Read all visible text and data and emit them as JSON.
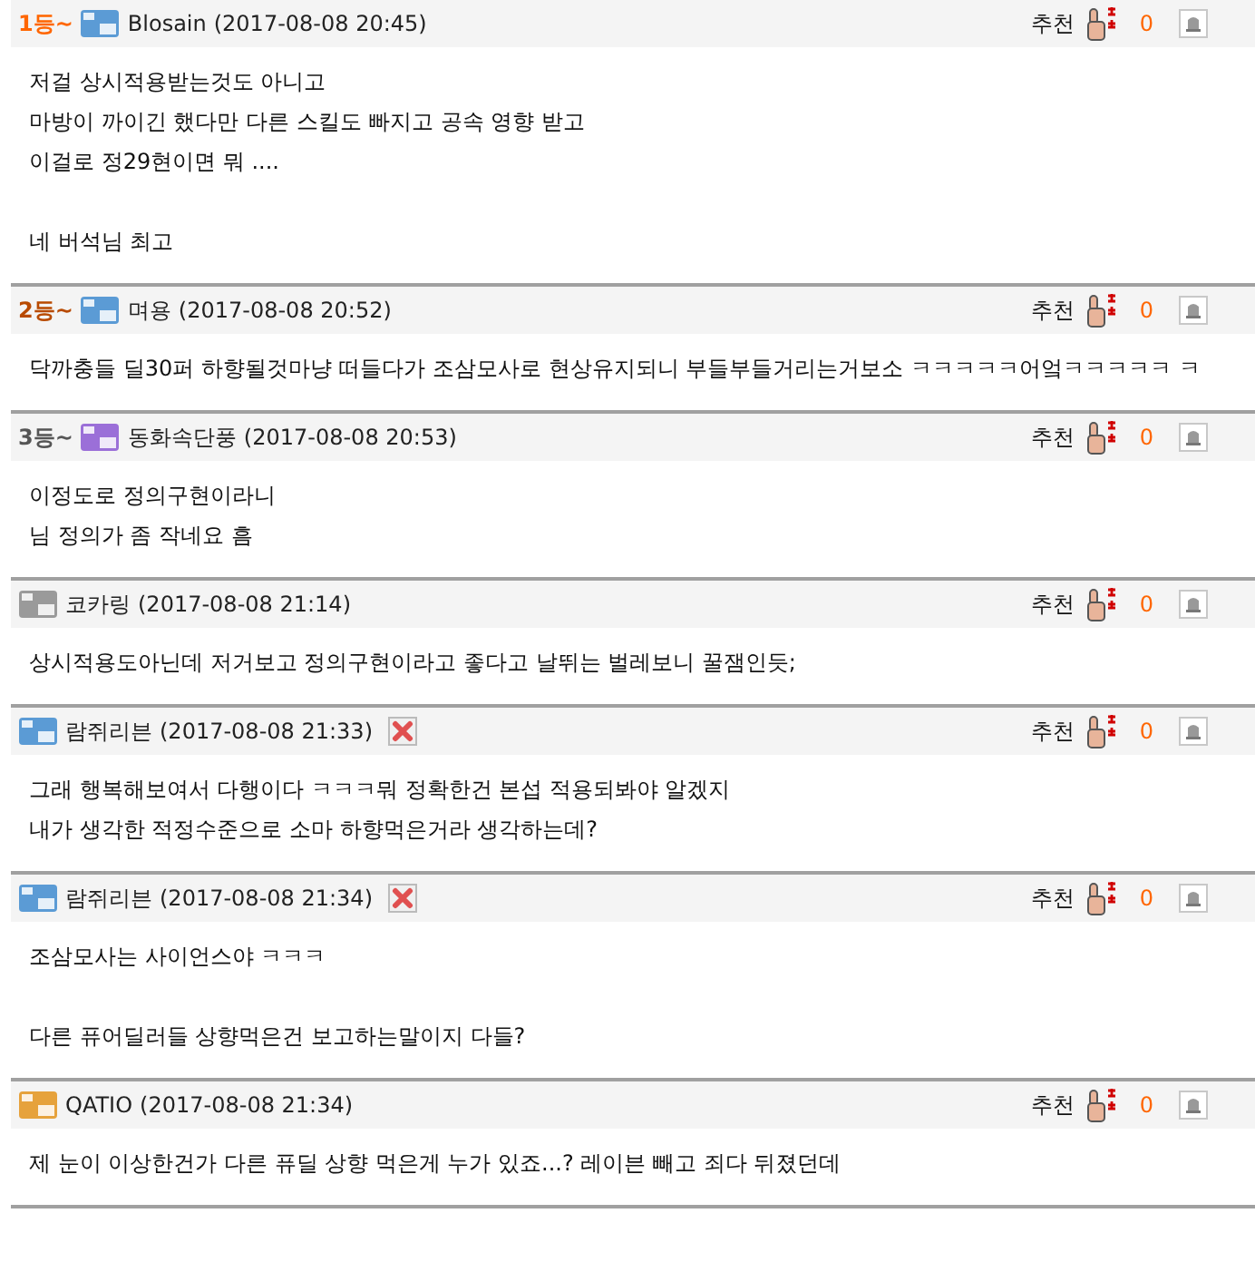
{
  "comments": [
    {
      "rank": {
        "text": "1등~",
        "color": "#ff6600"
      },
      "badge": {
        "color": "#5b9bd5"
      },
      "author": "Blosain",
      "time": "(2017-08-08 20:45)",
      "deletable": false,
      "recommend_label": "추천",
      "recommend_count": "0",
      "paragraphs": [
        [
          "저걸 상시적용받는것도 아니고",
          "마방이 까이긴 했다만 다른 스킬도 빠지고 공속 영향 받고",
          "이걸로 정29현이면 뭐 ...."
        ],
        [
          "네 버석님 최고"
        ]
      ]
    },
    {
      "rank": {
        "text": "2등~",
        "color": "#b84a00"
      },
      "badge": {
        "color": "#5b9bd5"
      },
      "author": "며용",
      "time": "(2017-08-08 20:52)",
      "deletable": false,
      "recommend_label": "추천",
      "recommend_count": "0",
      "paragraphs": [
        [
          "닥까충들 딜30퍼 하향될것마냥 떠들다가 조삼모사로 현상유지되니 부들부들거리는거보소 ㅋㅋㅋㅋㅋ어엌ㅋㅋㅋㅋㅋ ㅋ"
        ]
      ]
    },
    {
      "rank": {
        "text": "3등~",
        "color": "#555555"
      },
      "badge": {
        "color": "#9b6fd8"
      },
      "author": "동화속단풍",
      "time": "(2017-08-08 20:53)",
      "deletable": false,
      "recommend_label": "추천",
      "recommend_count": "0",
      "paragraphs": [
        [
          "이정도로 정의구현이라니",
          "님 정의가 좀 작네요 흠"
        ]
      ]
    },
    {
      "badge": {
        "color": "#9a9a9a"
      },
      "author": "코카링",
      "time": "(2017-08-08 21:14)",
      "deletable": false,
      "recommend_label": "추천",
      "recommend_count": "0",
      "paragraphs": [
        [
          "상시적용도아닌데 저거보고 정의구현이라고 좋다고 날뛰는 벌레보니 꿀잼인듯;"
        ]
      ]
    },
    {
      "badge": {
        "color": "#5b9bd5"
      },
      "author": "람쥐리븐",
      "time": "(2017-08-08 21:33)",
      "deletable": true,
      "recommend_label": "추천",
      "recommend_count": "0",
      "paragraphs": [
        [
          "그래 행복해보여서 다행이다 ㅋㅋㅋ뭐 정확한건 본섭 적용되봐야 알겠지",
          "내가 생각한 적정수준으로 소마 하향먹은거라 생각하는데?"
        ]
      ]
    },
    {
      "badge": {
        "color": "#5b9bd5"
      },
      "author": "람쥐리븐",
      "time": "(2017-08-08 21:34)",
      "deletable": true,
      "recommend_label": "추천",
      "recommend_count": "0",
      "paragraphs": [
        [
          "조삼모사는 사이언스야 ㅋㅋㅋ"
        ],
        [
          "다른 퓨어딜러들 상향먹은건 보고하는말이지 다들?"
        ]
      ]
    },
    {
      "badge": {
        "color": "#e6a23c"
      },
      "author": "QATIO",
      "time": "(2017-08-08 21:34)",
      "deletable": false,
      "recommend_label": "추천",
      "recommend_count": "0",
      "paragraphs": [
        [
          "제 눈이 이상한건가 다른 퓨딜 상향 먹은게 누가 있죠...? 레이븐 빼고 죄다 뒤졌던데"
        ]
      ]
    }
  ]
}
